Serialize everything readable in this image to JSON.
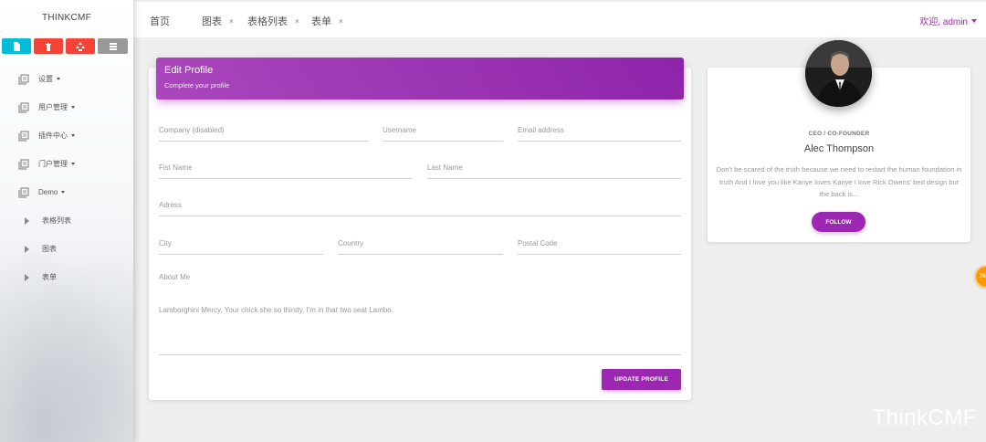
{
  "sidebar": {
    "brand": "THINKCMF",
    "quick_actions": [
      {
        "icon": "file-icon",
        "color": "#00bcd4"
      },
      {
        "icon": "trash-icon",
        "color": "#f44336"
      },
      {
        "icon": "recycle-icon",
        "color": "#f44336"
      },
      {
        "icon": "list-icon",
        "color": "#999999"
      }
    ],
    "menu": [
      {
        "label": "设置",
        "has_caret": true
      },
      {
        "label": "用户管理",
        "has_caret": true
      },
      {
        "label": "插件中心",
        "has_caret": true
      },
      {
        "label": "门户管理",
        "has_caret": true
      },
      {
        "label": "Demo",
        "has_caret": true
      }
    ],
    "submenu": [
      {
        "label": "表格列表"
      },
      {
        "label": "图表"
      },
      {
        "label": "表单"
      }
    ]
  },
  "topbar": {
    "tabs": [
      {
        "label": "首页",
        "closable": false
      },
      {
        "label": "图表",
        "closable": true
      },
      {
        "label": "表格列表",
        "closable": true
      },
      {
        "label": "表单",
        "closable": true
      }
    ],
    "close_glyph": "×",
    "user_label": "欢迎, admin"
  },
  "form": {
    "title": "Edit Profile",
    "subtitle": "Complete your profile",
    "fields": {
      "company": "Company (disabled)",
      "username": "Username",
      "email": "Email address",
      "first_name": "Fist Name",
      "last_name": "Last Name",
      "address": "Adress",
      "city": "City",
      "country": "Country",
      "postal_code": "Postal Code"
    },
    "about_label": "About Me",
    "about_text": "Lamborghini Mercy, Your chick she so thirsty, I'm in that two seat Lambo.",
    "submit_label": "UPDATE PROFILE"
  },
  "profile": {
    "role": "CEO / CO-FOUNDER",
    "name": "Alec Thompson",
    "bio": "Don't be scared of the truth because we need to restart the human foundation in truth And I love you like Kanye loves Kanye I love Rick Owens' bed design but the back is...",
    "follow_label": "FOLLOW"
  },
  "floating_badge": "76",
  "watermark": "ThinkCMF",
  "colors": {
    "accent": "#9c27b0",
    "cyan": "#00bcd4",
    "red": "#f44336",
    "orange": "#ff9800"
  }
}
